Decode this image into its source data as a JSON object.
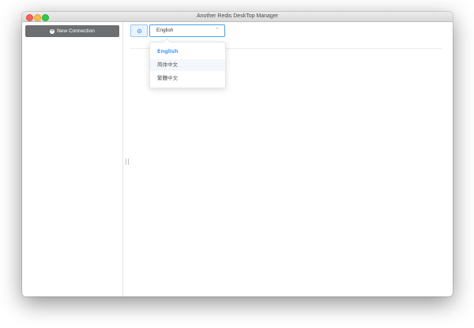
{
  "window": {
    "title": "Another Redis DeskTop Manager"
  },
  "sidebar": {
    "new_connection_label": "New Connection",
    "icon": "plus-circle-icon"
  },
  "settings": {
    "icon": "gear-icon"
  },
  "language_select": {
    "value": "English",
    "options": [
      "English",
      "简体中文",
      "繁體中文"
    ],
    "selected_index": 0
  },
  "colors": {
    "accent": "#409eff",
    "sidebar_button": "#6d6e70",
    "traffic_close": "#fc605c",
    "traffic_min": "#fdbc40",
    "traffic_max": "#34c84a"
  }
}
